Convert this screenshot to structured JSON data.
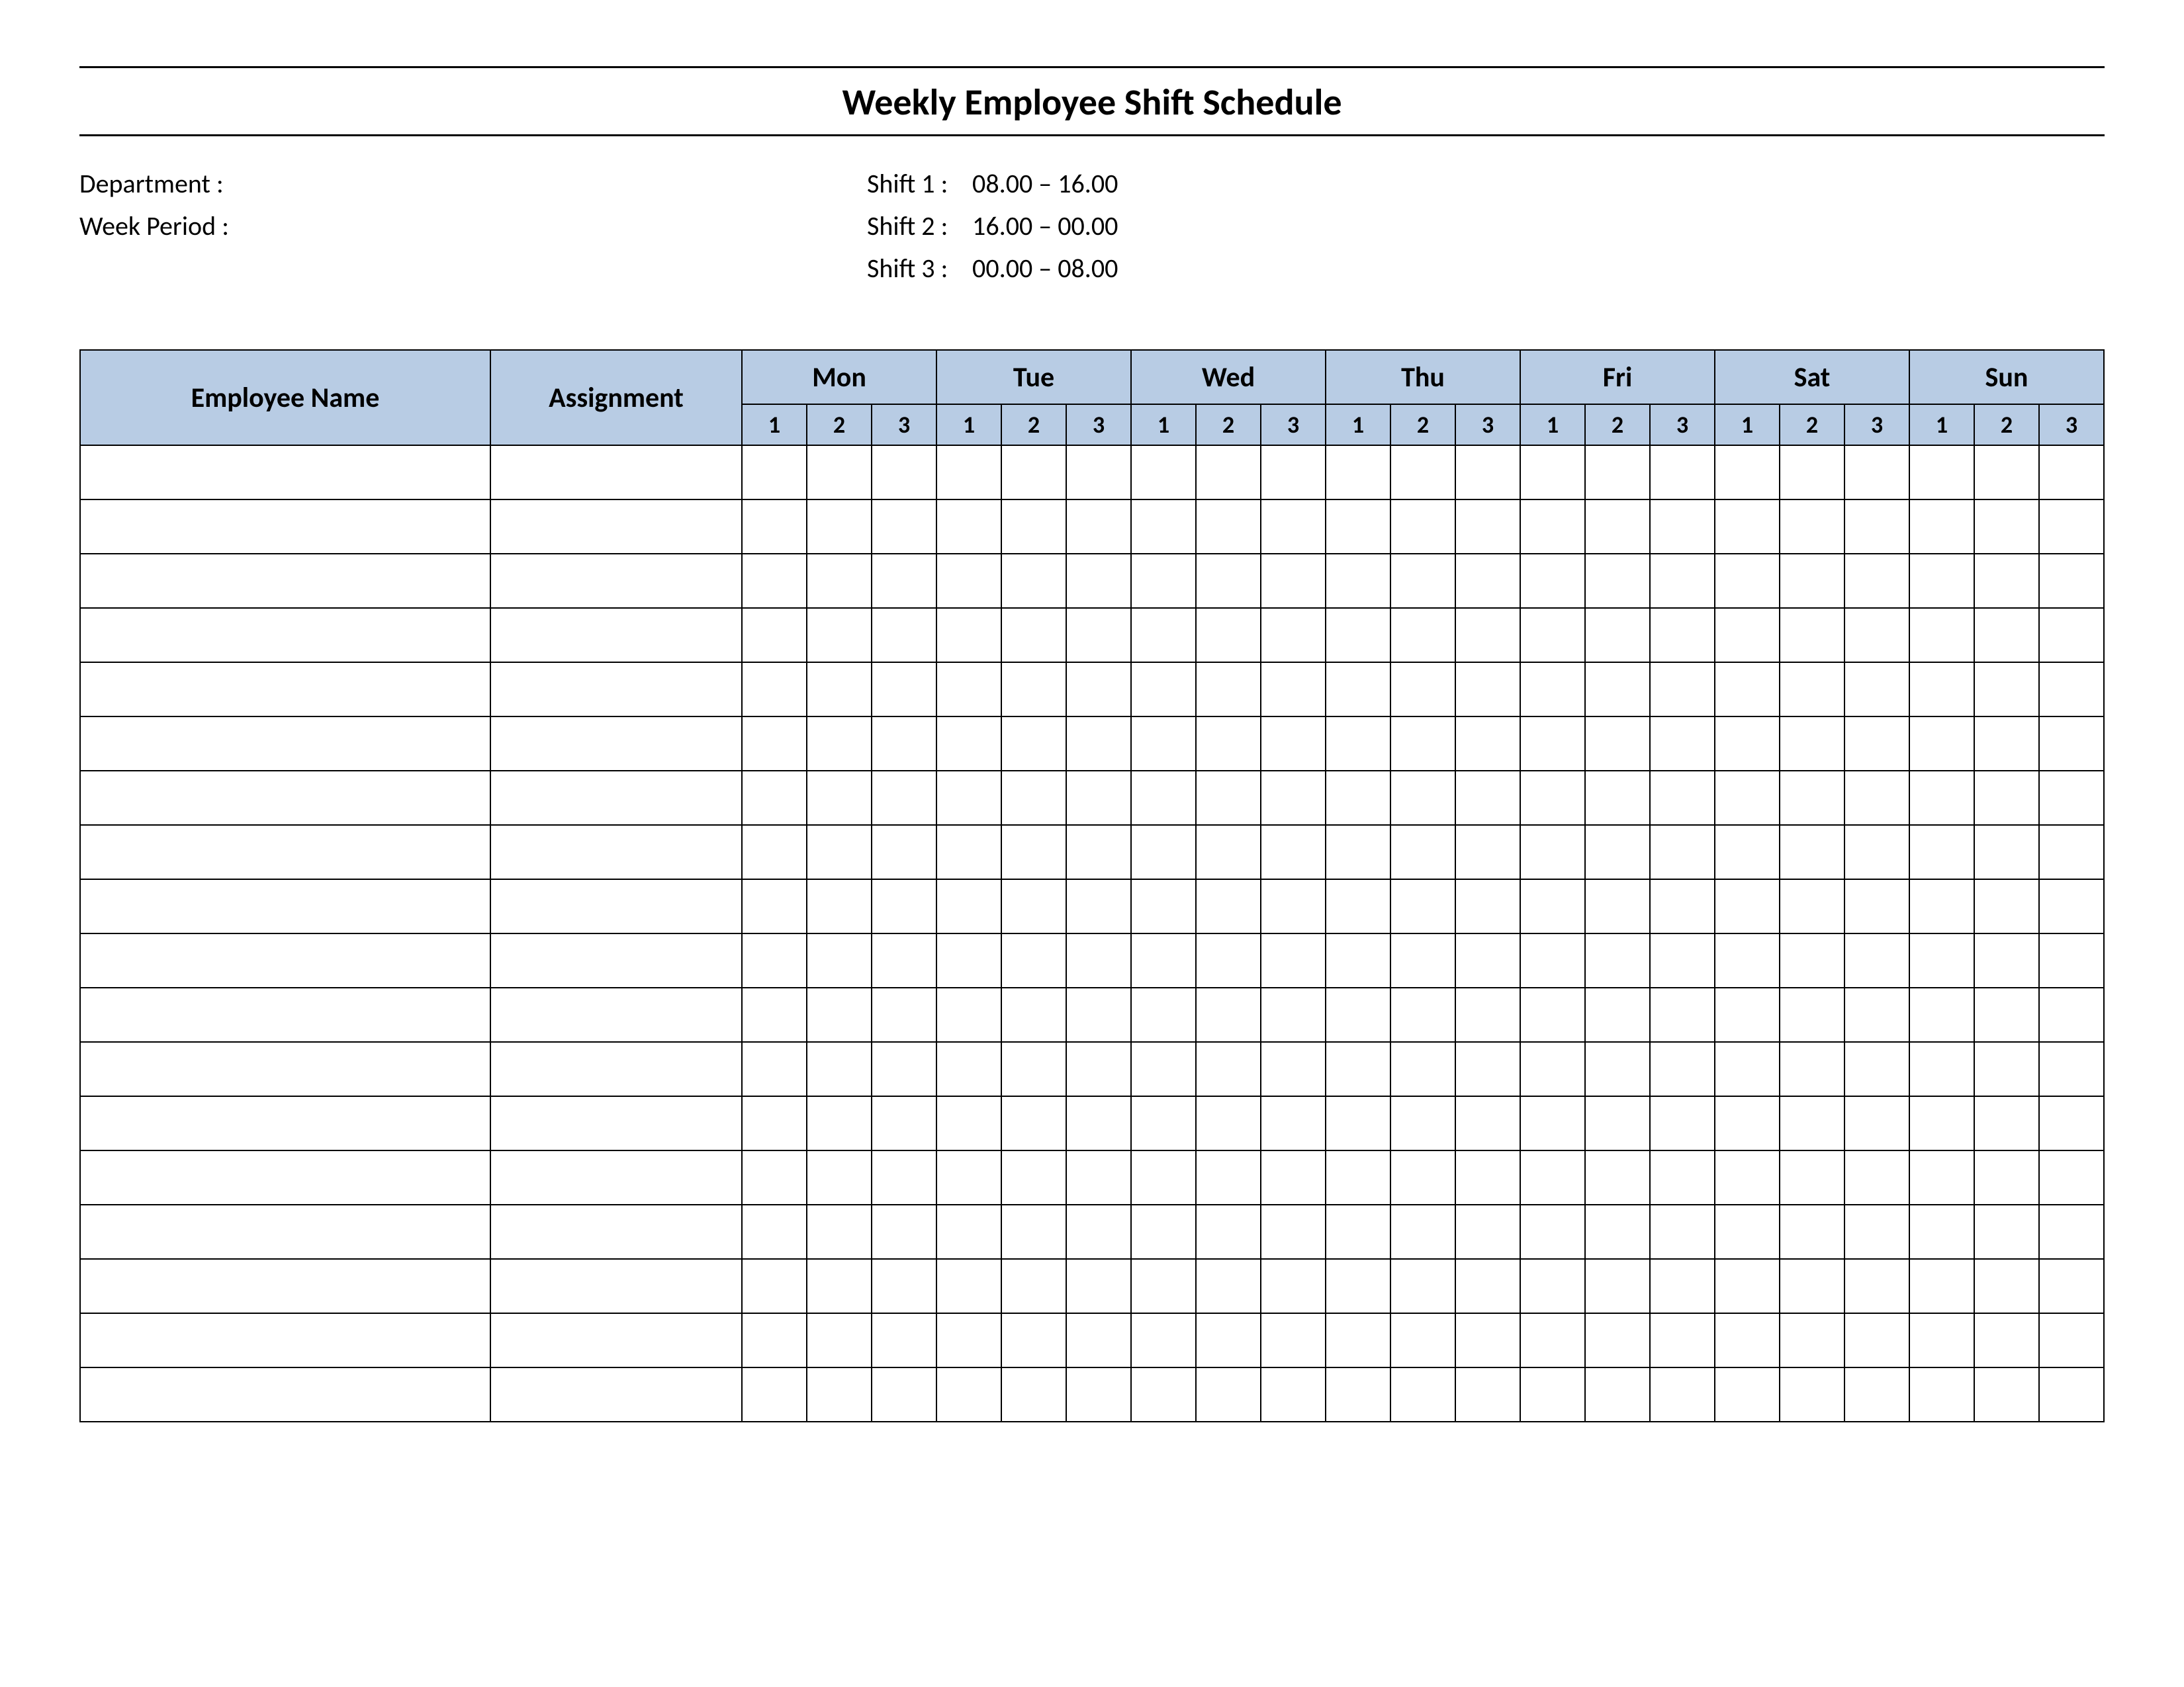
{
  "title": "Weekly Employee Shift Schedule",
  "meta": {
    "department_label": "Department    :",
    "department_value": "",
    "week_period_label": "Week  Period :",
    "week_period_value": "",
    "shifts": [
      {
        "label": "Shift 1  :",
        "time": "08.00  –  16.00"
      },
      {
        "label": "Shift 2  :",
        "time": "16.00  –  00.00"
      },
      {
        "label": "Shift 3  :",
        "time": "00.00  –  08.00"
      }
    ]
  },
  "headers": {
    "employee": "Employee Name",
    "assignment": "Assignment",
    "days": [
      "Mon",
      "Tue",
      "Wed",
      "Thu",
      "Fri",
      "Sat",
      "Sun"
    ],
    "sub": [
      "1",
      "2",
      "3"
    ]
  },
  "body_rows": 18
}
